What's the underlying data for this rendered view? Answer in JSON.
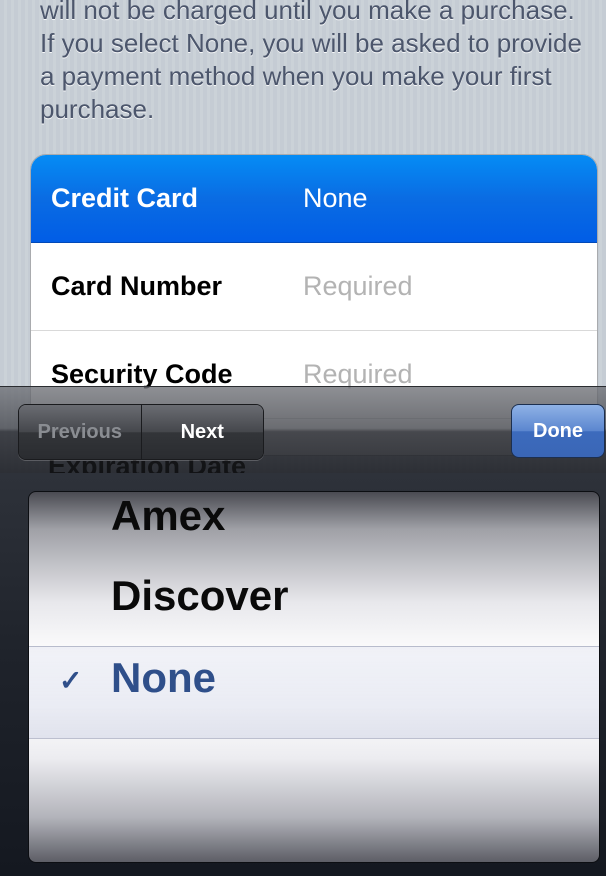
{
  "info_text": "will not be charged until you make a purchase. If you select None, you will be asked to provide a payment method when you make your first purchase.",
  "form": {
    "rows": [
      {
        "label": "Credit Card",
        "value": "None"
      },
      {
        "label": "Card Number",
        "value": "Required"
      },
      {
        "label": "Security Code",
        "value": "Required"
      }
    ],
    "next_row_label": "Expiration Date"
  },
  "toolbar": {
    "previous_label": "Previous",
    "next_label": "Next",
    "done_label": "Done"
  },
  "picker": {
    "options": [
      "Amex",
      "Discover",
      "None"
    ],
    "selected": "None",
    "check_mark": "✓"
  },
  "colors": {
    "selected_row": "#0a6ce3",
    "done_button": "#4a7acb",
    "picker_selected_text": "#2f4f8a"
  }
}
